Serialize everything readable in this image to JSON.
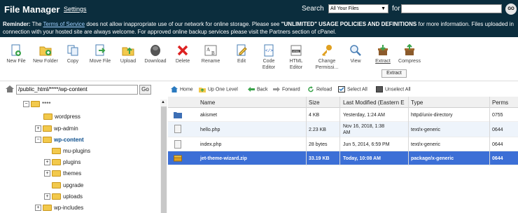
{
  "header": {
    "title": "File Manager",
    "settings_label": "Settings",
    "search_label": "Search",
    "search_scope": "All Your Files",
    "for_label": "for",
    "search_value": "",
    "go_label": "GO"
  },
  "reminder": {
    "lead": "Reminder:",
    "text_a": " The ",
    "tos_link": "Terms of Service",
    "text_b": " does not allow inappropriate use of our network for online storage. Please see ",
    "emphasis": "\"UNLIMITED\" USAGE POLICIES AND DEFINITIONS",
    "text_c": " for more information. Files uploaded in connection with your hosted site are always welcome. For approved online backup services please visit the Partners section of cPanel."
  },
  "toolbar": {
    "new_file": "New File",
    "new_folder": "New Folder",
    "copy": "Copy",
    "move_file": "Move File",
    "upload": "Upload",
    "download": "Download",
    "delete": "Delete",
    "rename": "Rename",
    "edit": "Edit",
    "code_editor": "Code Editor",
    "html_editor": "HTML Editor",
    "change_permissions": "Change Permissi...",
    "view": "View",
    "extract": "Extract",
    "compress": "Compress",
    "tooltip": "Extract"
  },
  "pathbar": {
    "path": "/public_html/****/wp-content",
    "go": "Go"
  },
  "navbar": {
    "home": "Home",
    "up": "Up One Level",
    "back": "Back",
    "forward": "Forward",
    "reload": "Reload",
    "select_all": "Select All",
    "unselect_all": "Unselect All"
  },
  "tree": {
    "root": "****",
    "items": [
      {
        "label": "wordpress"
      },
      {
        "label": "wp-admin"
      },
      {
        "label": "wp-content"
      },
      {
        "label": "mu-plugins"
      },
      {
        "label": "plugins"
      },
      {
        "label": "themes"
      },
      {
        "label": "upgrade"
      },
      {
        "label": "uploads"
      },
      {
        "label": "wp-includes"
      }
    ]
  },
  "grid": {
    "columns": {
      "name": "Name",
      "size": "Size",
      "modified": "Last Modified (Eastern E",
      "type": "Type",
      "perms": "Perms"
    },
    "rows": [
      {
        "name": "akismet",
        "size": "4 KB",
        "modified": "Yesterday, 1:24 AM",
        "modified2": "",
        "type": "httpd/unix-directory",
        "perms": "0755",
        "icon": "folder-icon"
      },
      {
        "name": "hello.php",
        "size": "2.23 KB",
        "modified": "Nov 16, 2018, 1:38",
        "modified2": "AM",
        "type": "text/x-generic",
        "perms": "0644",
        "icon": "file-icon"
      },
      {
        "name": "index.php",
        "size": "28 bytes",
        "modified": "Jun 5, 2014, 6:59 PM",
        "modified2": "",
        "type": "text/x-generic",
        "perms": "0644",
        "icon": "file-icon"
      },
      {
        "name": "jet-theme-wizard.zip",
        "size": "33.19 KB",
        "modified": "Today, 10:08 AM",
        "modified2": "",
        "type": "package/x-generic",
        "perms": "0644",
        "icon": "archive-icon"
      }
    ]
  },
  "colors": {
    "header_bg": "#0b2d3d",
    "selected_row": "#3c6fd6",
    "link": "#9fd0ff",
    "folder": "#f2c94c"
  }
}
